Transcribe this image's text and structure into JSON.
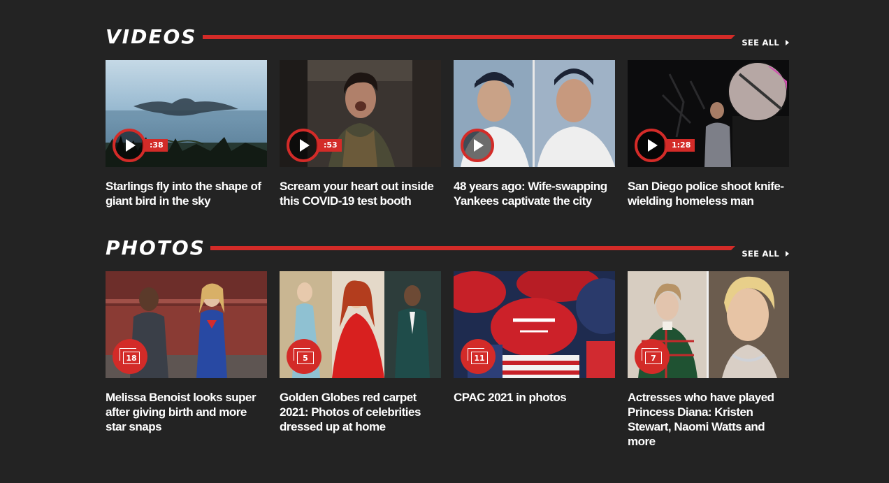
{
  "videos": {
    "title": "VIDEOS",
    "see_all": "SEE ALL",
    "items": [
      {
        "title": "Starlings fly into the shape of giant bird in the sky",
        "duration": ":38"
      },
      {
        "title": "Scream your heart out inside this COVID-19 test booth",
        "duration": ":53"
      },
      {
        "title": "48 years ago: Wife-swapping Yankees captivate the city",
        "duration": ""
      },
      {
        "title": "San Diego police shoot knife-wielding homeless man",
        "duration": "1:28"
      }
    ]
  },
  "photos": {
    "title": "PHOTOS",
    "see_all": "SEE ALL",
    "items": [
      {
        "title": "Melissa Benoist looks super after giving birth and more star snaps",
        "count": "18"
      },
      {
        "title": "Golden Globes red carpet 2021: Photos of celebrities dressed up at home",
        "count": "5"
      },
      {
        "title": "CPAC 2021 in photos",
        "count": "11"
      },
      {
        "title": "Actresses who have played Princess Diana: Kristen Stewart, Naomi Watts and more",
        "count": "7"
      }
    ]
  },
  "colors": {
    "background": "#232323",
    "accent": "#d32b28",
    "text": "#ffffff"
  }
}
